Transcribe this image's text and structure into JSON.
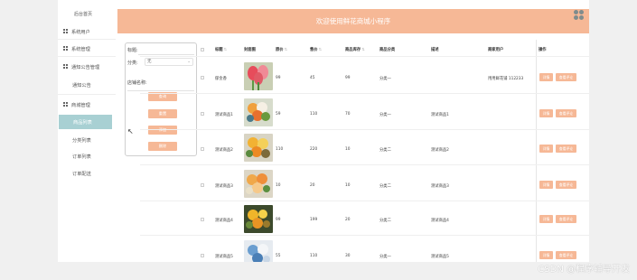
{
  "header": {
    "title": "欢迎使用鲜花商城小程序"
  },
  "sidebar": {
    "home": "后台首页",
    "items": [
      {
        "label": "系统用户",
        "icon": "grid-icon"
      },
      {
        "label": "系统管理",
        "icon": "grid-icon"
      },
      {
        "label": "通知公告管理",
        "icon": "grid-icon"
      },
      {
        "label": "通知公告",
        "icon": ""
      },
      {
        "label": "商城管理",
        "icon": "grid-icon"
      },
      {
        "label": "商品列表",
        "icon": ""
      },
      {
        "label": "分类列表",
        "icon": ""
      },
      {
        "label": "订单列表",
        "icon": ""
      },
      {
        "label": "订单配送",
        "icon": ""
      }
    ]
  },
  "search": {
    "title_label": "标题:",
    "category_label": "分类:",
    "category_value": "无",
    "shop_label": "店铺名称:",
    "buttons": [
      "查询",
      "重置",
      "添加",
      "删除"
    ]
  },
  "table": {
    "headers": [
      "标题",
      "封面图",
      "原价",
      "售价",
      "商品库存",
      "商品分类",
      "描述",
      "商家用户",
      "操作"
    ],
    "rows": [
      {
        "title": "郁金香",
        "price": "99",
        "sale": "45",
        "stock": "99",
        "category": "分类一",
        "desc": "",
        "merchant": "用用鲜花铺 112233"
      },
      {
        "title": "测试商品1",
        "price": "59",
        "sale": "110",
        "stock": "70",
        "category": "分类一",
        "desc": "测试商品1",
        "merchant": ""
      },
      {
        "title": "测试商品2",
        "price": "110",
        "sale": "220",
        "stock": "10",
        "category": "分类二",
        "desc": "测试商品2",
        "merchant": ""
      },
      {
        "title": "测试商品3",
        "price": "10",
        "sale": "20",
        "stock": "10",
        "category": "分类二",
        "desc": "测试商品3",
        "merchant": ""
      },
      {
        "title": "测试商品4",
        "price": "99",
        "sale": "199",
        "stock": "20",
        "category": "分类二",
        "desc": "测试商品4",
        "merchant": ""
      },
      {
        "title": "测试商品5",
        "price": "55",
        "sale": "110",
        "stock": "30",
        "category": "分类一",
        "desc": "测试商品5",
        "merchant": ""
      }
    ],
    "row_buttons": [
      "详情",
      "查看评论"
    ]
  },
  "watermark": "CSDN @程序辅导开发",
  "colors": {
    "accent": "#f6b896",
    "active_nav": "#a8d0d3"
  }
}
